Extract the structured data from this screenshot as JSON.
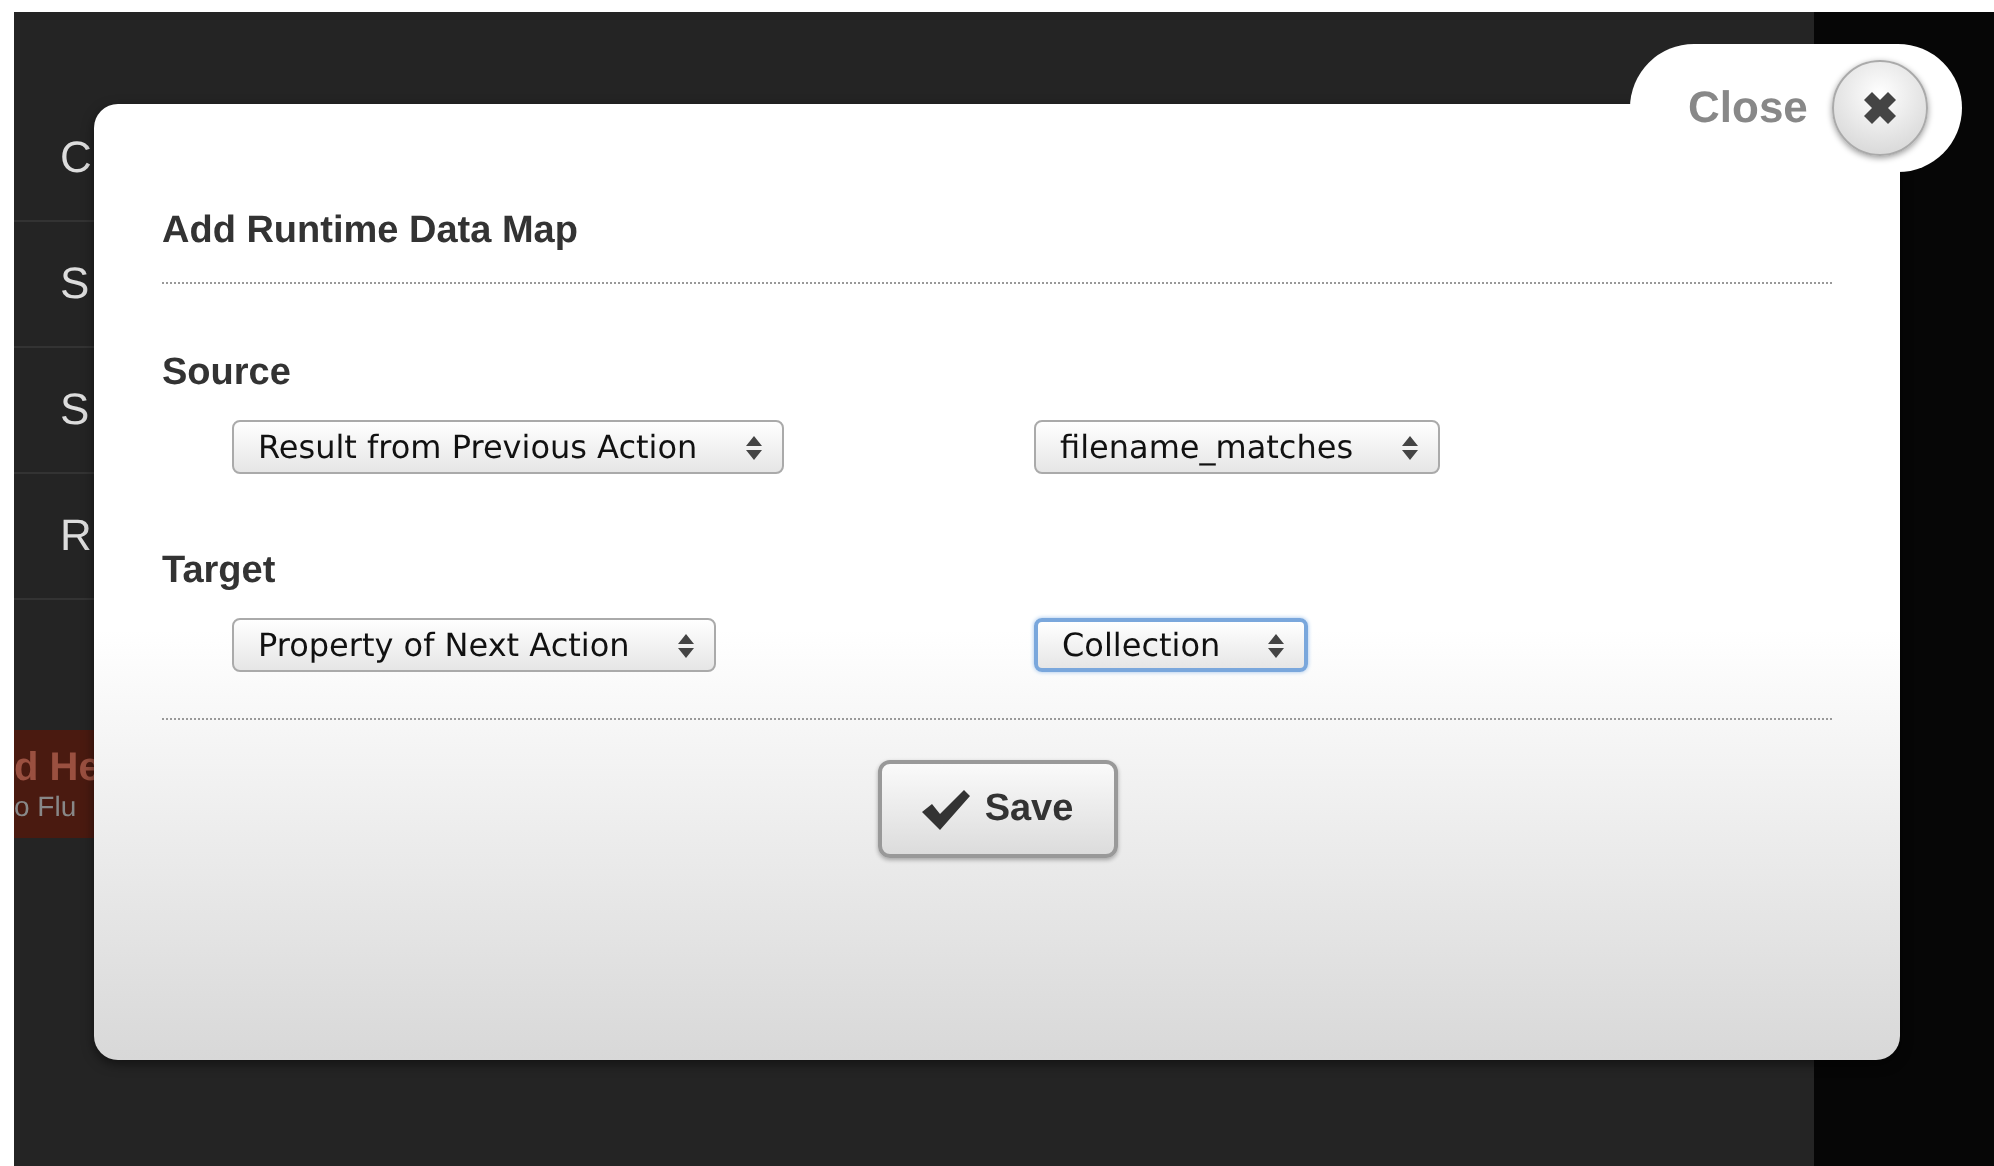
{
  "background": {
    "rows": [
      "C",
      "S",
      "S",
      "R"
    ],
    "banner": {
      "title": "d He",
      "subtitle": "o Flu"
    }
  },
  "dialog": {
    "close_label": "Close",
    "title": "Add Runtime Data Map",
    "sections": [
      {
        "heading": "Source",
        "selects": [
          {
            "value": "Result from Previous Action",
            "focused": false
          },
          {
            "value": "filename_matches",
            "focused": false
          }
        ]
      },
      {
        "heading": "Target",
        "selects": [
          {
            "value": "Property of Next Action",
            "focused": false
          },
          {
            "value": "Collection",
            "focused": true
          }
        ]
      }
    ],
    "save_label": "Save"
  }
}
